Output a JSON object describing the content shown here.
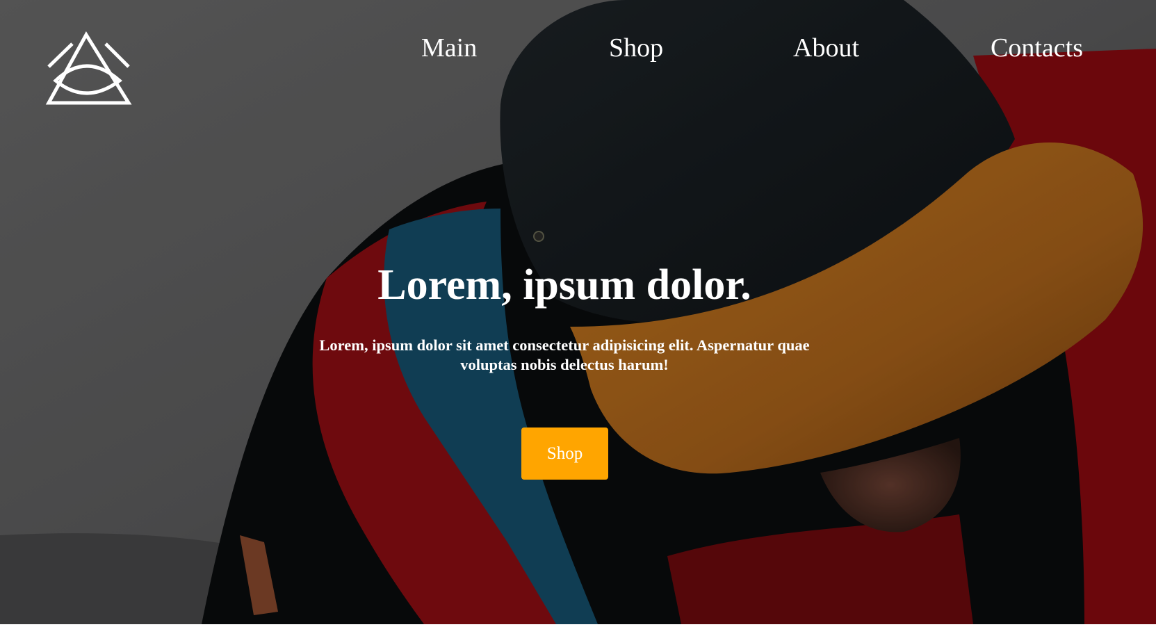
{
  "nav": {
    "items": [
      {
        "label": "Main"
      },
      {
        "label": "Shop"
      },
      {
        "label": "About"
      },
      {
        "label": "Contacts"
      }
    ]
  },
  "logo": {
    "icon": "triangle-eye-logo-icon"
  },
  "hero": {
    "title": "Lorem, ipsum dolor.",
    "subtitle": "Lorem, ipsum dolor sit amet consectetur adipisicing elit. Aspernatur quae voluptas nobis delectus harum!",
    "cta_label": "Shop",
    "background": "photo of a man in a black cap with a tan suede brim and a red, blue and black jacket"
  },
  "colors": {
    "accent": "#ffa500",
    "text": "#ffffff"
  }
}
